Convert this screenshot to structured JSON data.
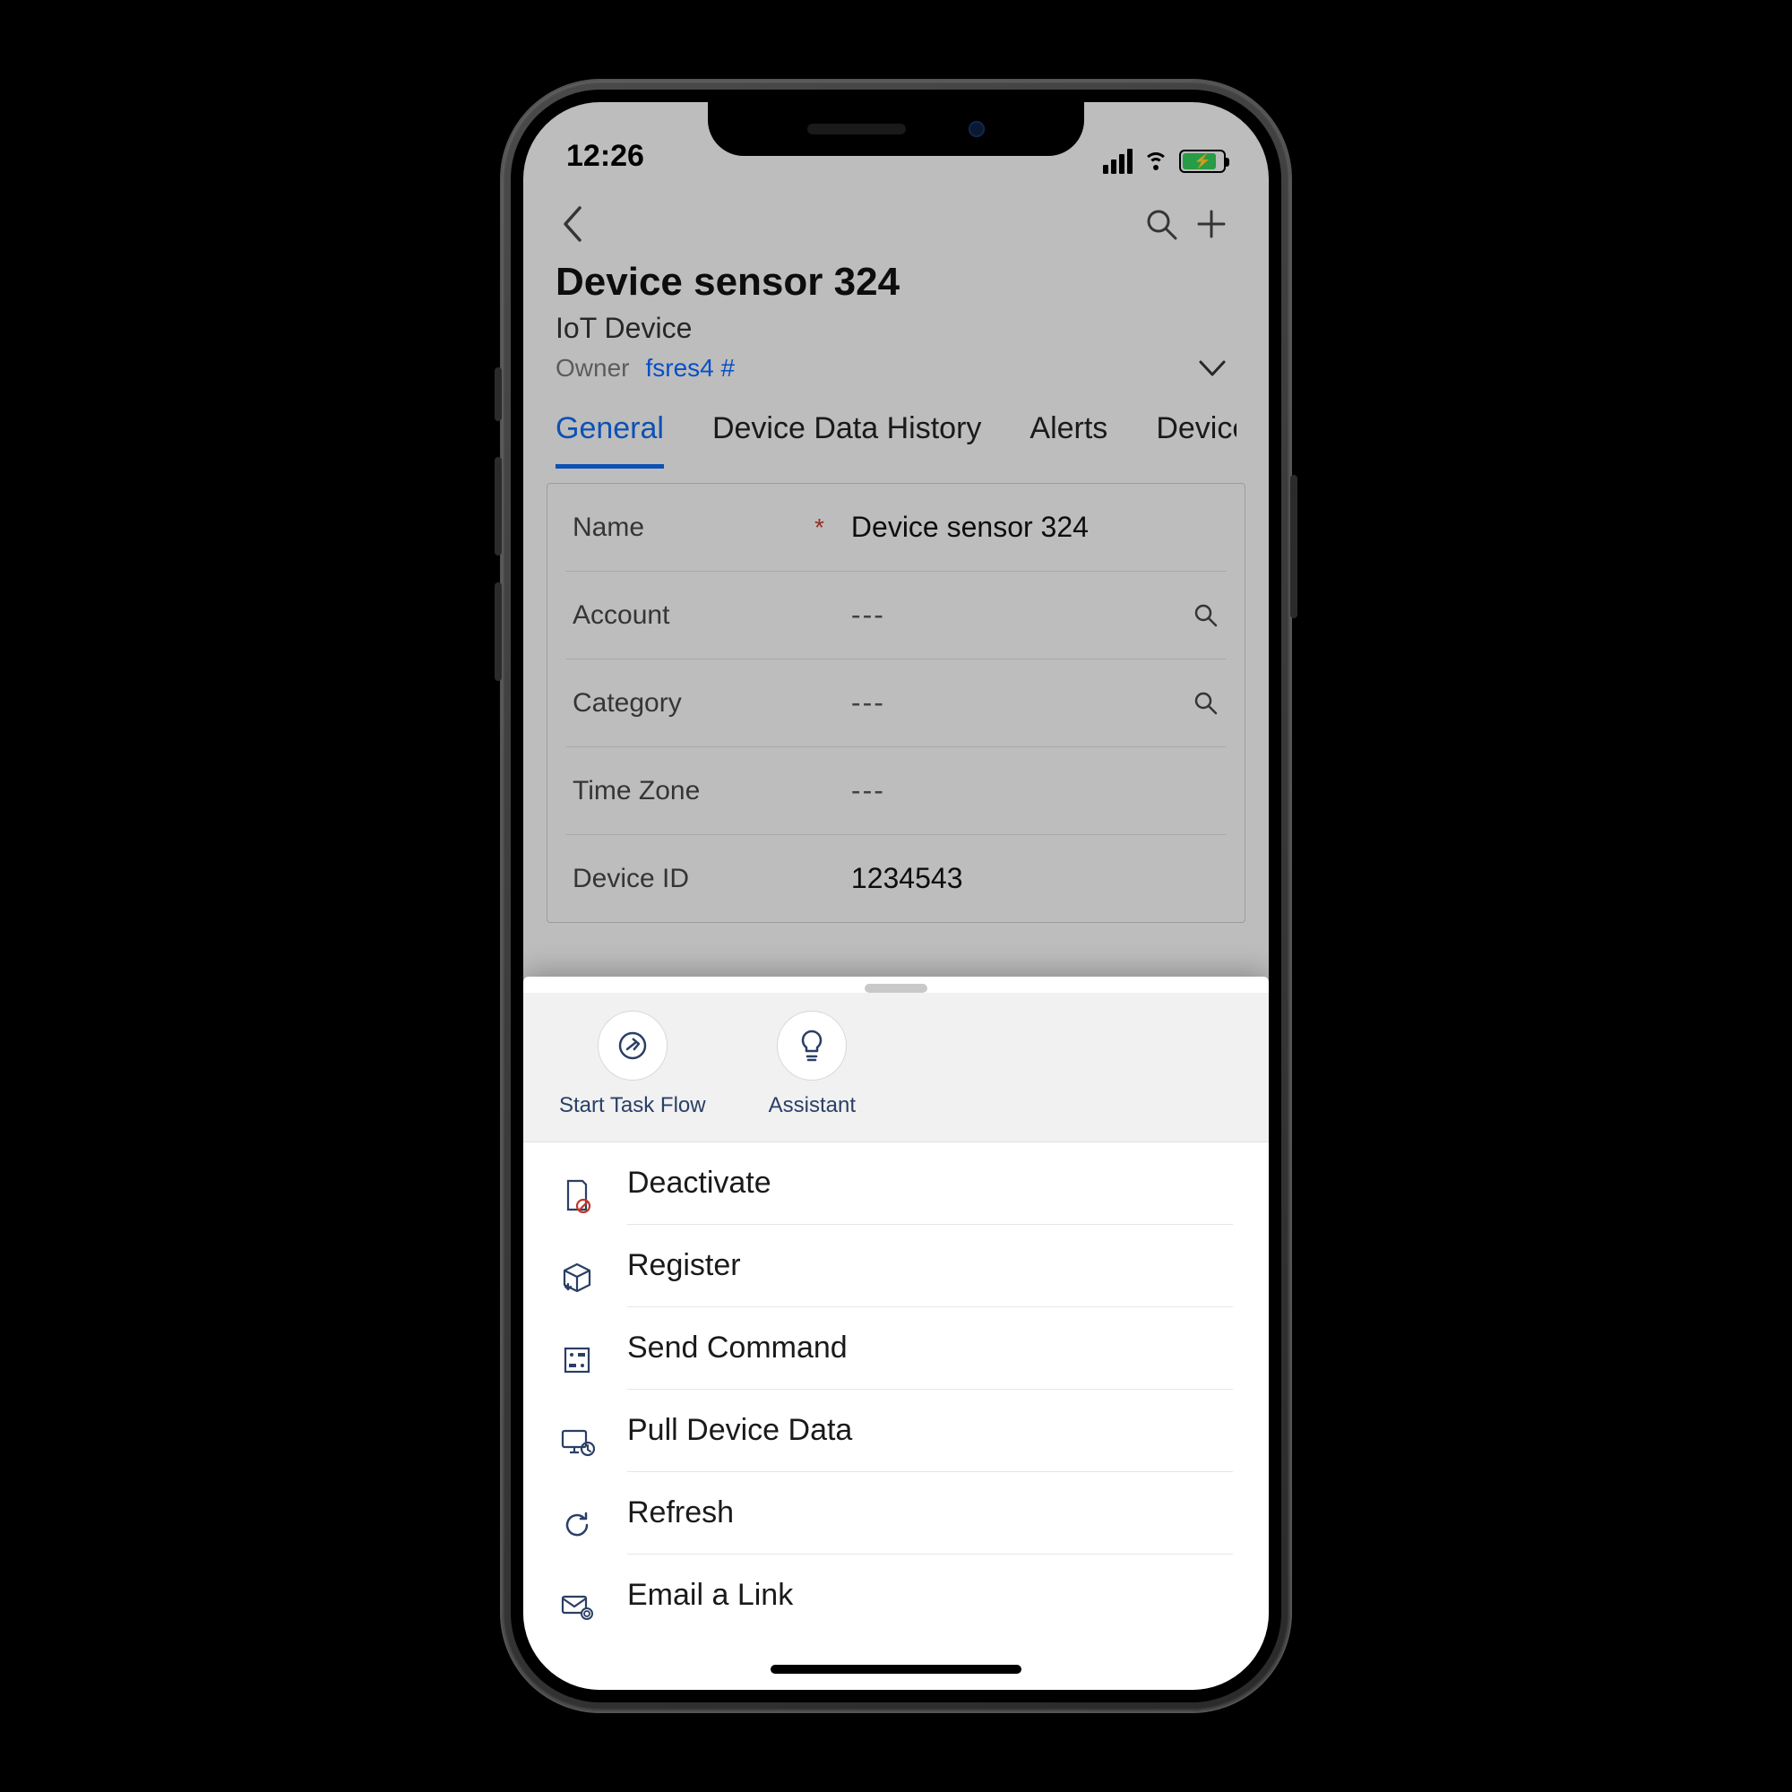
{
  "status": {
    "time": "12:26"
  },
  "header": {
    "title": "Device sensor 324",
    "subtitle": "IoT Device",
    "owner_label": "Owner",
    "owner_value": "fsres4 #"
  },
  "tabs": [
    {
      "label": "General",
      "active": true
    },
    {
      "label": "Device Data History",
      "active": false
    },
    {
      "label": "Alerts",
      "active": false
    },
    {
      "label": "Device R",
      "active": false
    }
  ],
  "fields": {
    "name": {
      "label": "Name",
      "value": "Device sensor 324",
      "required": true,
      "lookup": false
    },
    "account": {
      "label": "Account",
      "value": "---",
      "required": false,
      "lookup": true
    },
    "category": {
      "label": "Category",
      "value": "---",
      "required": false,
      "lookup": true
    },
    "timezone": {
      "label": "Time Zone",
      "value": "---",
      "required": false,
      "lookup": false
    },
    "device_id": {
      "label": "Device ID",
      "value": "1234543",
      "required": false,
      "lookup": false
    }
  },
  "sheet": {
    "quick": [
      {
        "key": "start-task-flow",
        "label": "Start Task Flow"
      },
      {
        "key": "assistant",
        "label": "Assistant"
      }
    ],
    "actions": [
      {
        "key": "deactivate",
        "label": "Deactivate"
      },
      {
        "key": "register",
        "label": "Register"
      },
      {
        "key": "send-command",
        "label": "Send Command"
      },
      {
        "key": "pull-data",
        "label": "Pull Device Data"
      },
      {
        "key": "refresh",
        "label": "Refresh"
      },
      {
        "key": "email-link",
        "label": "Email a Link"
      }
    ]
  }
}
